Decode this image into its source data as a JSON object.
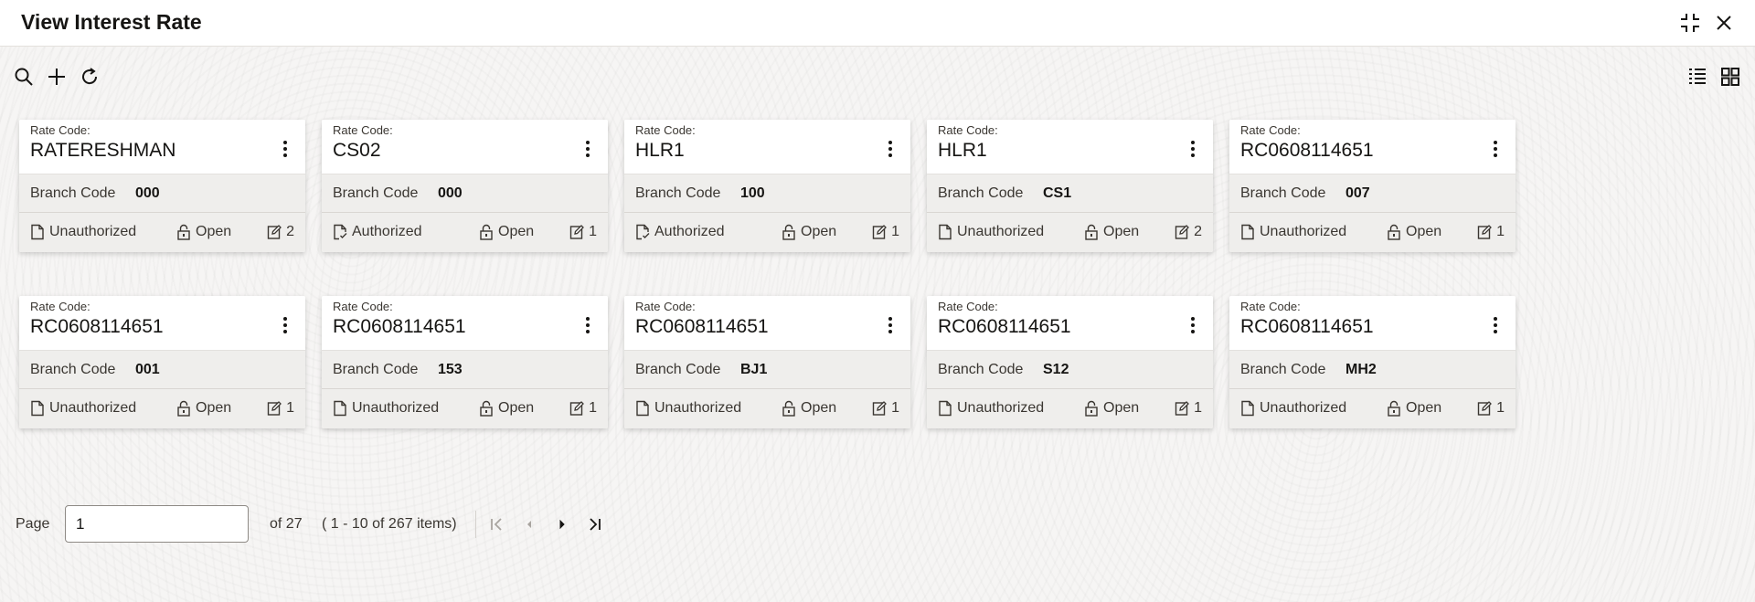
{
  "window": {
    "title": "View Interest Rate"
  },
  "cards": [
    {
      "rate_label": "Rate Code:",
      "rate_code": "RATERESHMAN",
      "branch_label": "Branch Code",
      "branch_code": "000",
      "auth": "Unauthorized",
      "status": "Open",
      "mods": "2"
    },
    {
      "rate_label": "Rate Code:",
      "rate_code": "CS02",
      "branch_label": "Branch Code",
      "branch_code": "000",
      "auth": "Authorized",
      "status": "Open",
      "mods": "1"
    },
    {
      "rate_label": "Rate Code:",
      "rate_code": "HLR1",
      "branch_label": "Branch Code",
      "branch_code": "100",
      "auth": "Authorized",
      "status": "Open",
      "mods": "1"
    },
    {
      "rate_label": "Rate Code:",
      "rate_code": "HLR1",
      "branch_label": "Branch Code",
      "branch_code": "CS1",
      "auth": "Unauthorized",
      "status": "Open",
      "mods": "2"
    },
    {
      "rate_label": "Rate Code:",
      "rate_code": "RC0608114651",
      "branch_label": "Branch Code",
      "branch_code": "007",
      "auth": "Unauthorized",
      "status": "Open",
      "mods": "1"
    },
    {
      "rate_label": "Rate Code:",
      "rate_code": "RC0608114651",
      "branch_label": "Branch Code",
      "branch_code": "001",
      "auth": "Unauthorized",
      "status": "Open",
      "mods": "1"
    },
    {
      "rate_label": "Rate Code:",
      "rate_code": "RC0608114651",
      "branch_label": "Branch Code",
      "branch_code": "153",
      "auth": "Unauthorized",
      "status": "Open",
      "mods": "1"
    },
    {
      "rate_label": "Rate Code:",
      "rate_code": "RC0608114651",
      "branch_label": "Branch Code",
      "branch_code": "BJ1",
      "auth": "Unauthorized",
      "status": "Open",
      "mods": "1"
    },
    {
      "rate_label": "Rate Code:",
      "rate_code": "RC0608114651",
      "branch_label": "Branch Code",
      "branch_code": "S12",
      "auth": "Unauthorized",
      "status": "Open",
      "mods": "1"
    },
    {
      "rate_label": "Rate Code:",
      "rate_code": "RC0608114651",
      "branch_label": "Branch Code",
      "branch_code": "MH2",
      "auth": "Unauthorized",
      "status": "Open",
      "mods": "1"
    }
  ],
  "pagination": {
    "page_label": "Page",
    "current_page": "1",
    "of_text": "of 27",
    "range_text": "( 1 - 10 of 267 items)"
  },
  "icons": {
    "header": [
      "minimize-icon",
      "close-icon"
    ],
    "toolbar": [
      "search-icon",
      "add-icon",
      "refresh-icon",
      "list-view-icon",
      "tile-view-icon"
    ],
    "card": [
      "kebab-menu-icon",
      "document-icon",
      "document-authorized-icon",
      "unlock-icon",
      "edit-icon"
    ],
    "pager": [
      "first-page-icon",
      "previous-page-icon",
      "next-page-icon",
      "last-page-icon"
    ]
  }
}
